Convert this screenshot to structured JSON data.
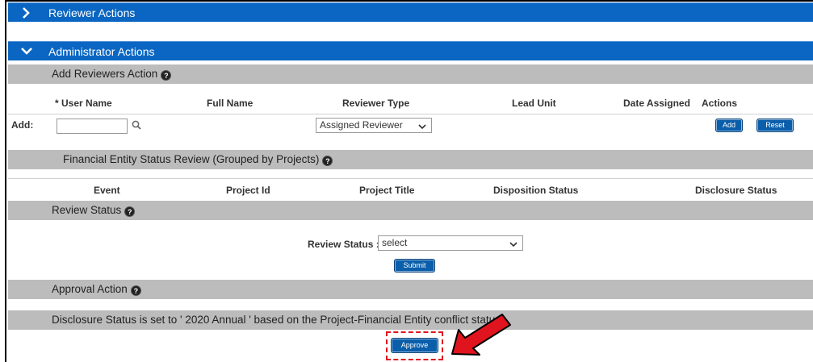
{
  "sections": {
    "reviewer_actions": "Reviewer Actions",
    "administrator_actions": "Administrator Actions"
  },
  "add_reviewers": {
    "title": "Add Reviewers Action",
    "columns": {
      "required_mark": "*",
      "user_name": "User Name",
      "full_name": "Full Name",
      "reviewer_type": "Reviewer Type",
      "lead_unit": "Lead Unit",
      "date_assigned": "Date Assigned",
      "actions": "Actions"
    },
    "add_label": "Add:",
    "user_name_value": "",
    "reviewer_type_value": "Assigned Reviewer",
    "add_button": "Add",
    "reset_button": "Reset"
  },
  "financial_entity": {
    "title": "Financial Entity Status Review (Grouped by Projects)",
    "columns": {
      "event": "Event",
      "project_id": "Project Id",
      "project_title": "Project Title",
      "disposition_status": "Disposition Status",
      "disclosure_status": "Disclosure Status"
    }
  },
  "review_status": {
    "title": "Review Status",
    "label": "Review Status :",
    "select_value": "select",
    "submit_button": "Submit"
  },
  "approval_action": {
    "title": "Approval Action",
    "message": "Disclosure Status is set to ' 2020 Annual ' based on the Project-Financial Entity conflict status.",
    "approve_button": "Approve"
  },
  "colors": {
    "header_blue": "#0a66c2",
    "subheader_gray": "#bcbcbc",
    "button_blue": "#0a5eaa",
    "highlight_red": "#e0141e"
  },
  "help_glyph": "?"
}
